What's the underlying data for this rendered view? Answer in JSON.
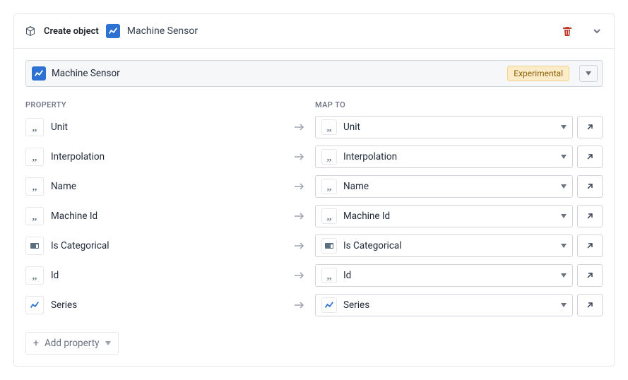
{
  "header": {
    "title": "Create object",
    "subtitle": "Machine Sensor"
  },
  "entity": {
    "name": "Machine Sensor",
    "badge": "Experimental"
  },
  "columns": {
    "property": "PROPERTY",
    "mapTo": "MAP TO"
  },
  "rows": [
    {
      "type": "string",
      "property": "Unit",
      "mapType": "string",
      "mapTo": "Unit"
    },
    {
      "type": "string",
      "property": "Interpolation",
      "mapType": "string",
      "mapTo": "Interpolation"
    },
    {
      "type": "string",
      "property": "Name",
      "mapType": "string",
      "mapTo": "Name"
    },
    {
      "type": "string",
      "property": "Machine Id",
      "mapType": "string",
      "mapTo": "Machine Id"
    },
    {
      "type": "bool",
      "property": "Is Categorical",
      "mapType": "bool",
      "mapTo": "Is Categorical"
    },
    {
      "type": "string",
      "property": "Id",
      "mapType": "string",
      "mapTo": "Id"
    },
    {
      "type": "chart",
      "property": "Series",
      "mapType": "chart",
      "mapTo": "Series"
    }
  ],
  "buttons": {
    "addProperty": "Add property"
  }
}
